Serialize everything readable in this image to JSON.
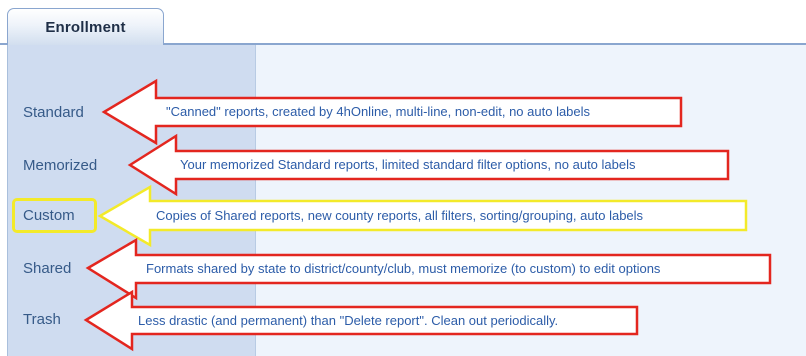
{
  "tab": {
    "label": "Enrollment"
  },
  "nav": {
    "items": [
      {
        "label": "Standard"
      },
      {
        "label": "Memorized"
      },
      {
        "label": "Custom"
      },
      {
        "label": "Shared"
      },
      {
        "label": "Trash"
      }
    ]
  },
  "annotations": [
    {
      "text": "\"Canned\" reports, created by 4hOnline, multi-line, non-edit, no auto labels"
    },
    {
      "text": "Your memorized Standard reports, limited standard filter options, no auto labels"
    },
    {
      "text": "Copies of Shared reports, new county reports, all filters, sorting/grouping, auto labels"
    },
    {
      "text": "Formats shared by state to district/county/club, must memorize (to custom) to edit options"
    },
    {
      "text": "Less drastic (and permanent) than \"Delete report\". Clean out periodically."
    }
  ],
  "colors": {
    "arrow_outline": "#e3261f",
    "highlight_outline": "#f3ea2a",
    "nav_text": "#365a88",
    "annotation_text": "#2c5ca8"
  }
}
